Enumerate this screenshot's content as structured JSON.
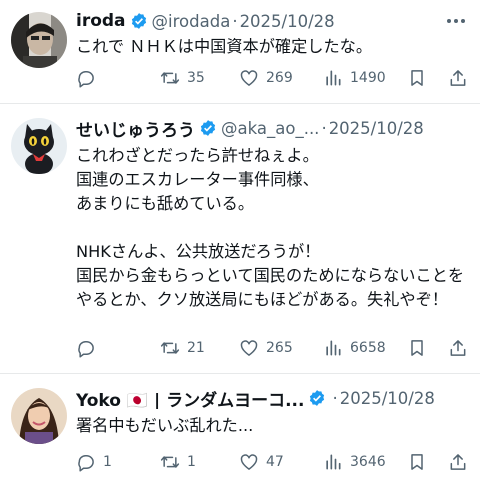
{
  "tweets": [
    {
      "name": "iroda",
      "handle": "@irodada",
      "date": "2025/10/28",
      "text": "これで ＮＨＫは中国資本が確定したな。",
      "replies": "",
      "retweets": "35",
      "likes": "269",
      "views": "1490"
    },
    {
      "name": "せいじゅうろう",
      "handle": "@aka_ao_...",
      "date": "2025/10/28",
      "text": "これわざとだったら許せねぇよ。\n国連のエスカレーター事件同様、\nあまりにも舐めている。\n\nNHKさんよ、公共放送だろうが！\n国民から金もらっといて国民のためにならないことをやるとか、クソ放送局にもほどがある。失礼やぞ！",
      "replies": "",
      "retweets": "21",
      "likes": "265",
      "views": "6658"
    },
    {
      "name": "Yoko 🇯🇵 | ランダムヨーコ...",
      "handle": "",
      "date": "2025/10/28",
      "text": "署名中もだいぶ乱れた...",
      "replies": "1",
      "retweets": "1",
      "likes": "47",
      "views": "3646"
    }
  ],
  "separator": "·",
  "icons": [
    "verified-badge-icon",
    "more-icon",
    "reply-icon",
    "retweet-icon",
    "like-icon",
    "views-icon",
    "bookmark-icon",
    "share-icon"
  ],
  "colors": {
    "verified": "#1d9bf0",
    "text": "#0f1419",
    "muted": "#536471",
    "divider": "#e7e9ea"
  }
}
